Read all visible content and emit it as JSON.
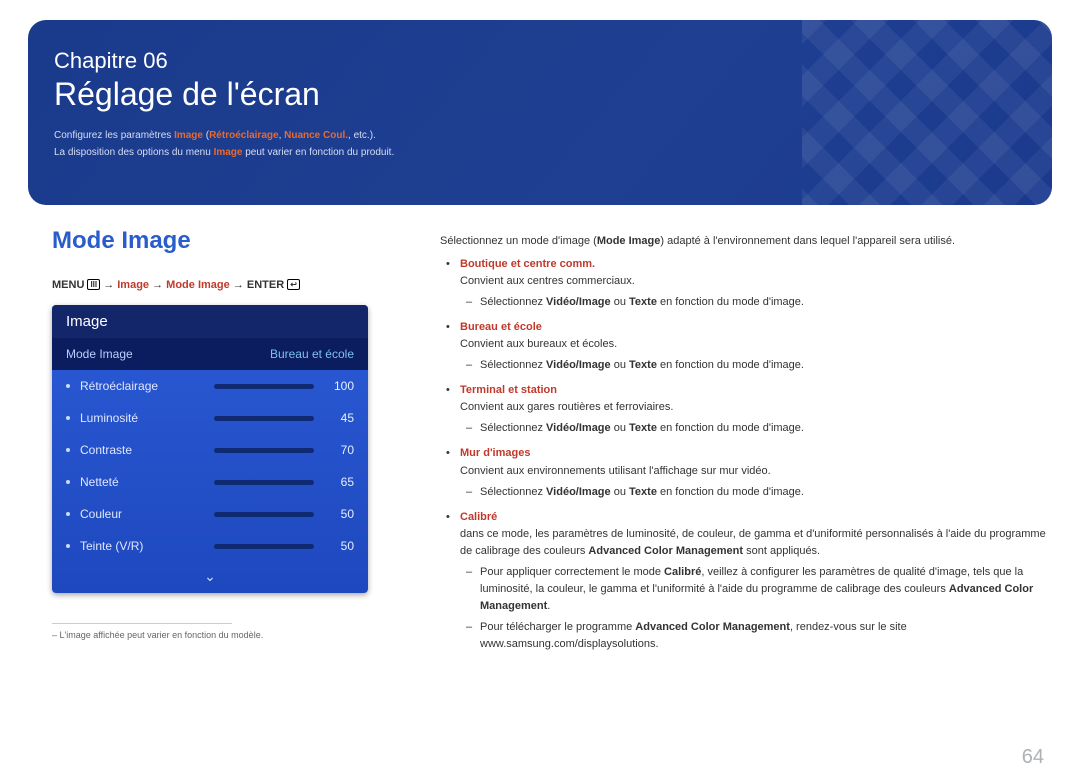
{
  "hero": {
    "chapter": "Chapitre 06",
    "title": "Réglage de l'écran",
    "intro1_a": "Configurez les paramètres ",
    "intro1_b": "Image",
    "intro1_c": " (",
    "intro1_d": "Rétroéclairage",
    "intro1_e": ", ",
    "intro1_f": "Nuance Coul.",
    "intro1_g": ", etc.).",
    "intro2_a": "La disposition des options du menu ",
    "intro2_b": "Image",
    "intro2_c": " peut varier en fonction du produit."
  },
  "section_title": "Mode Image",
  "menupath": {
    "menu": "MENU",
    "icon1": "III",
    "arrow": " → ",
    "step1": "Image",
    "step2": "Mode Image",
    "enter": "ENTER",
    "icon2": "↩"
  },
  "osd": {
    "head": "Image",
    "selected_label": "Mode Image",
    "selected_value": "Bureau et école",
    "rows": [
      {
        "label": "Rétroéclairage",
        "value": 100
      },
      {
        "label": "Luminosité",
        "value": 45
      },
      {
        "label": "Contraste",
        "value": 70
      },
      {
        "label": "Netteté",
        "value": 65
      },
      {
        "label": "Couleur",
        "value": 50
      },
      {
        "label": "Teinte (V/R)",
        "value": 50
      }
    ]
  },
  "footnote": "L'image affichée peut varier en fonction du modèle.",
  "right": {
    "lead_a": "Sélectionnez un mode d'image (",
    "lead_b": "Mode Image",
    "lead_c": ") adapté à l'environnement dans lequel l'appareil sera utilisé.",
    "modes": [
      {
        "name": "Boutique et centre comm.",
        "desc": "Convient aux centres commerciaux.",
        "sub": [
          {
            "a": "Sélectionnez ",
            "b": "Vidéo/Image",
            "c": " ou ",
            "d": "Texte",
            "e": " en fonction du mode d'image."
          }
        ]
      },
      {
        "name": "Bureau et école",
        "desc": "Convient aux bureaux et écoles.",
        "sub": [
          {
            "a": "Sélectionnez ",
            "b": "Vidéo/Image",
            "c": " ou ",
            "d": "Texte",
            "e": " en fonction du mode d'image."
          }
        ]
      },
      {
        "name": "Terminal et station",
        "desc": "Convient aux gares routières et ferroviaires.",
        "sub": [
          {
            "a": "Sélectionnez ",
            "b": "Vidéo/Image",
            "c": " ou ",
            "d": "Texte",
            "e": " en fonction du mode d'image."
          }
        ]
      },
      {
        "name": "Mur d'images",
        "desc": "Convient aux environnements utilisant l'affichage sur mur vidéo.",
        "sub": [
          {
            "a": "Sélectionnez ",
            "b": "Vidéo/Image",
            "c": " ou ",
            "d": "Texte",
            "e": " en fonction du mode d'image."
          }
        ]
      }
    ],
    "calibre": {
      "name": "Calibré",
      "desc_a": "dans ce mode, les paramètres de luminosité, de couleur, de gamma et d'uniformité personnalisés à l'aide du programme de calibrage des couleurs ",
      "desc_b": "Advanced Color Management",
      "desc_c": " sont appliqués.",
      "sub1_a": "Pour appliquer correctement le mode ",
      "sub1_b": "Calibré",
      "sub1_c": ", veillez à configurer les paramètres de qualité d'image, tels que la luminosité, la couleur, le gamma et l'uniformité à l'aide du programme de calibrage des couleurs ",
      "sub1_d": "Advanced Color Management",
      "sub1_e": ".",
      "sub2_a": "Pour télécharger le programme ",
      "sub2_b": "Advanced Color Management",
      "sub2_c": ", rendez-vous sur le site www.samsung.com/displaysolutions."
    }
  },
  "page_number": "64"
}
